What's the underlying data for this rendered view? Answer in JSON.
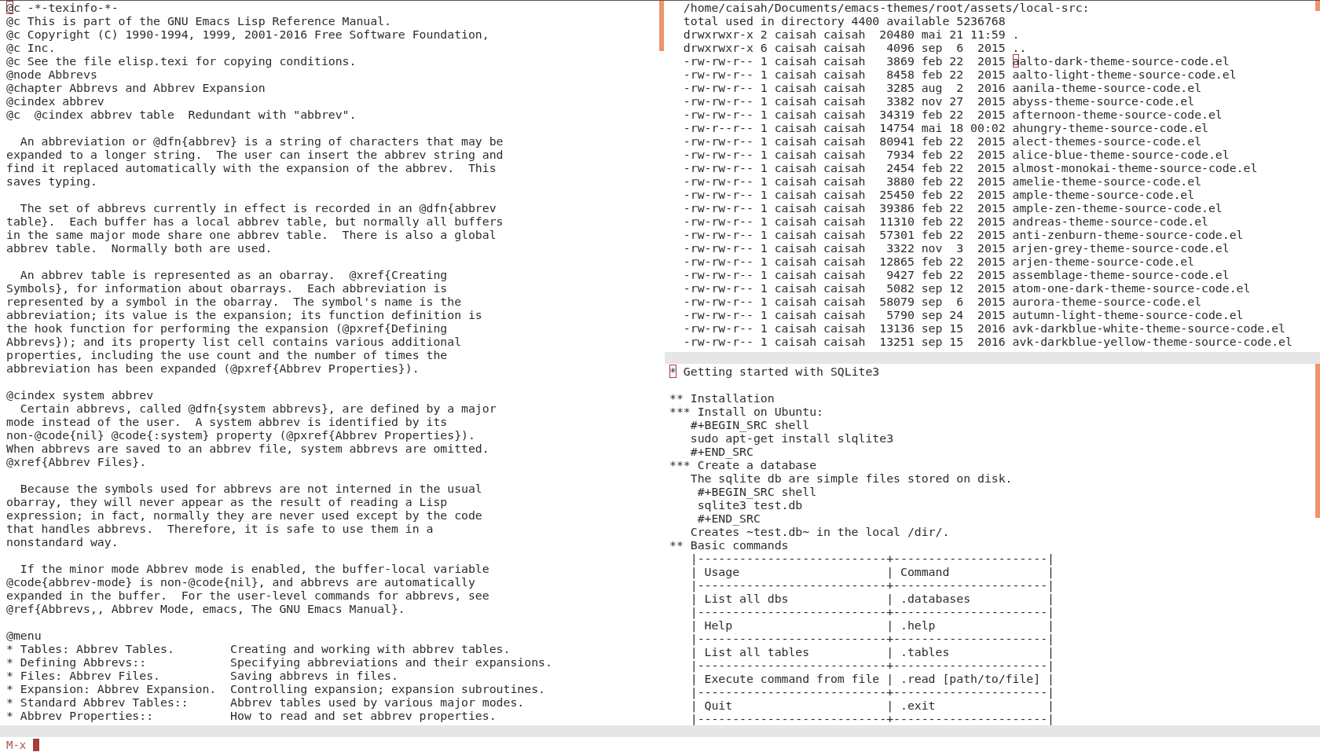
{
  "left_window": {
    "blocks": [
      [
        {
          "at": "@",
          "after": "c -*-texinfo-*-"
        },
        "@c This is part of the GNU Emacs Lisp Reference Manual.",
        "@c Copyright (C) 1990-1994, 1999, 2001-2016 Free Software Foundation,",
        "@c Inc.",
        "@c See the file elisp.texi for copying conditions.",
        "@node Abbrevs",
        "@chapter Abbrevs and Abbrev Expansion",
        "@cindex abbrev",
        "@c  @cindex abbrev table  Redundant with \"abbrev\"."
      ],
      [
        "  An abbreviation or @dfn{abbrev} is a string of characters that may be",
        "expanded to a longer string.  The user can insert the abbrev string and",
        "find it replaced automatically with the expansion of the abbrev.  This",
        "saves typing."
      ],
      [
        "  The set of abbrevs currently in effect is recorded in an @dfn{abbrev",
        "table}.  Each buffer has a local abbrev table, but normally all buffers",
        "in the same major mode share one abbrev table.  There is also a global",
        "abbrev table.  Normally both are used."
      ],
      [
        "  An abbrev table is represented as an obarray.  @xref{Creating",
        "Symbols}, for information about obarrays.  Each abbreviation is",
        "represented by a symbol in the obarray.  The symbol's name is the",
        "abbreviation; its value is the expansion; its function definition is",
        "the hook function for performing the expansion (@pxref{Defining",
        "Abbrevs}); and its property list cell contains various additional",
        "properties, including the use count and the number of times the",
        "abbreviation has been expanded (@pxref{Abbrev Properties})."
      ],
      [
        "@cindex system abbrev",
        "  Certain abbrevs, called @dfn{system abbrevs}, are defined by a major",
        "mode instead of the user.  A system abbrev is identified by its",
        "non-@code{nil} @code{:system} property (@pxref{Abbrev Properties}).",
        "When abbrevs are saved to an abbrev file, system abbrevs are omitted.",
        "@xref{Abbrev Files}."
      ],
      [
        "  Because the symbols used for abbrevs are not interned in the usual",
        "obarray, they will never appear as the result of reading a Lisp",
        "expression; in fact, normally they are never used except by the code",
        "that handles abbrevs.  Therefore, it is safe to use them in a",
        "nonstandard way."
      ],
      [
        "  If the minor mode Abbrev mode is enabled, the buffer-local variable",
        "@code{abbrev-mode} is non-@code{nil}, and abbrevs are automatically",
        "expanded in the buffer.  For the user-level commands for abbrevs, see",
        "@ref{Abbrevs,, Abbrev Mode, emacs, The GNU Emacs Manual}."
      ],
      [
        "@menu",
        "* Tables: Abbrev Tables.        Creating and working with abbrev tables.",
        "* Defining Abbrevs::            Specifying abbreviations and their expansions.",
        "* Files: Abbrev Files.          Saving abbrevs in files.",
        "* Expansion: Abbrev Expansion.  Controlling expansion; expansion subroutines.",
        "* Standard Abbrev Tables::      Abbrev tables used by various major modes.",
        "* Abbrev Properties::           How to read and set abbrev properties."
      ]
    ]
  },
  "top_right_window": {
    "blocks": [
      [
        "  /home/caisah/Documents/emacs-themes/root/assets/local-src:",
        "  total used in directory 4400 available 5236768",
        "  drwxrwxr-x 2 caisah caisah  20480 mai 21 11:59 .",
        "  drwxrwxr-x 6 caisah caisah   4096 sep  6  2015 ..",
        {
          "before": "  -rw-rw-r-- 1 caisah caisah   3869 feb 22  2015 ",
          "at": "a",
          "after": "alto-dark-theme-source-code.el"
        },
        "  -rw-rw-r-- 1 caisah caisah   8458 feb 22  2015 aalto-light-theme-source-code.el",
        "  -rw-rw-r-- 1 caisah caisah   3285 aug  2  2016 aanila-theme-source-code.el",
        "  -rw-rw-r-- 1 caisah caisah   3382 nov 27  2015 abyss-theme-source-code.el",
        "  -rw-rw-r-- 1 caisah caisah  34319 feb 22  2015 afternoon-theme-source-code.el",
        "  -rw-r--r-- 1 caisah caisah  14754 mai 18 00:02 ahungry-theme-source-code.el",
        "  -rw-rw-r-- 1 caisah caisah  80941 feb 22  2015 alect-themes-source-code.el",
        "  -rw-rw-r-- 1 caisah caisah   7934 feb 22  2015 alice-blue-theme-source-code.el",
        "  -rw-rw-r-- 1 caisah caisah   2454 feb 22  2015 almost-monokai-theme-source-code.el",
        "  -rw-rw-r-- 1 caisah caisah   3880 feb 22  2015 amelie-theme-source-code.el",
        "  -rw-rw-r-- 1 caisah caisah  25450 feb 22  2015 ample-theme-source-code.el",
        "  -rw-rw-r-- 1 caisah caisah  39386 feb 22  2015 ample-zen-theme-source-code.el",
        "  -rw-rw-r-- 1 caisah caisah  11310 feb 22  2015 andreas-theme-source-code.el",
        "  -rw-rw-r-- 1 caisah caisah  57301 feb 22  2015 anti-zenburn-theme-source-code.el",
        "  -rw-rw-r-- 1 caisah caisah   3322 nov  3  2015 arjen-grey-theme-source-code.el",
        "  -rw-rw-r-- 1 caisah caisah  12865 feb 22  2015 arjen-theme-source-code.el",
        "  -rw-rw-r-- 1 caisah caisah   9427 feb 22  2015 assemblage-theme-source-code.el",
        "  -rw-rw-r-- 1 caisah caisah   5082 sep 12  2015 atom-one-dark-theme-source-code.el",
        "  -rw-rw-r-- 1 caisah caisah  58079 sep  6  2015 aurora-theme-source-code.el",
        "  -rw-rw-r-- 1 caisah caisah   5790 sep 24  2015 autumn-light-theme-source-code.el",
        "  -rw-rw-r-- 1 caisah caisah  13136 sep 15  2016 avk-darkblue-white-theme-source-code.el",
        "  -rw-rw-r-- 1 caisah caisah  13251 sep 15  2016 avk-darkblue-yellow-theme-source-code.el"
      ]
    ]
  },
  "bottom_right_window": {
    "blocks": [
      [
        {
          "at": "*",
          "after": " Getting started with SQLite3"
        }
      ],
      [
        "** Installation",
        "*** Install on Ubuntu:",
        "   #+BEGIN_SRC shell",
        "   sudo apt-get install slqlite3",
        "   #+END_SRC",
        "*** Create a database",
        "   The sqlite db are simple files stored on disk.",
        "    #+BEGIN_SRC shell",
        "    sqlite3 test.db",
        "    #+END_SRC",
        "   Creates ~test.db~ in the local /dir/.",
        "** Basic commands",
        "   |---------------------------+----------------------|",
        "   | Usage                     | Command              |",
        "   |---------------------------+----------------------|",
        "   | List all dbs              | .databases           |",
        "   |---------------------------+----------------------|",
        "   | Help                      | .help                |",
        "   |---------------------------+----------------------|",
        "   | List all tables           | .tables              |",
        "   |---------------------------+----------------------|",
        "   | Execute command from file | .read [path/to/file] |",
        "   |---------------------------+----------------------|",
        "   | Quit                      | .exit                |",
        "   |---------------------------+----------------------|"
      ]
    ]
  },
  "minibuffer": {
    "prompt": "M-x"
  }
}
